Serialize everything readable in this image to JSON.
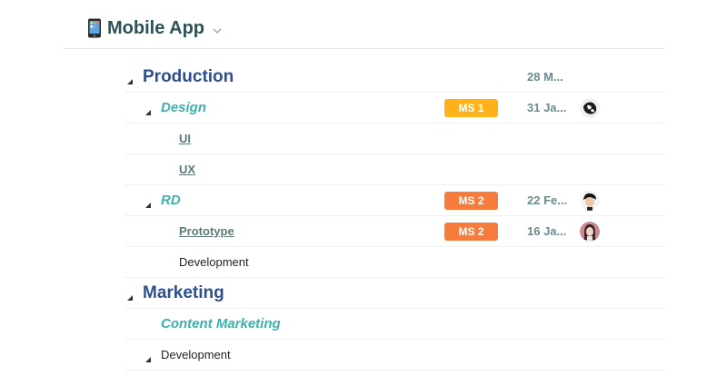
{
  "header": {
    "icon": "mobile-phone-icon",
    "title": "Mobile App",
    "dropdown_icon": "chevron-down-icon"
  },
  "colors": {
    "title": "#2b5354",
    "level0": "#2d4f8e",
    "level1": "#3fb0ac",
    "level2": "#5c7a78",
    "date": "#6b8c8f",
    "badge_ms1": "#fdb21a",
    "badge_ms2": "#f57c3c"
  },
  "rows": [
    {
      "label": "Production",
      "level": 0,
      "date": "28 M..."
    },
    {
      "label": "Design",
      "level": 1,
      "milestone": "MS 1",
      "date": "31 Ja...",
      "avatar": "avatar-icon"
    },
    {
      "label": "UI",
      "level": 2
    },
    {
      "label": "UX",
      "level": 2
    },
    {
      "label": "RD",
      "level": 1,
      "milestone": "MS 2",
      "date": "22 Fe...",
      "avatar": "avatar-icon"
    },
    {
      "label": "Prototype",
      "level": 2,
      "milestone": "MS 2",
      "date": "16 Ja...",
      "avatar": "avatar-icon"
    },
    {
      "label": "Development",
      "level": 2,
      "style": "plain"
    },
    {
      "label": "Marketing",
      "level": 0
    },
    {
      "label": "Content Marketing",
      "level": 1
    },
    {
      "label": "Development",
      "level": 1,
      "style": "plain"
    }
  ]
}
